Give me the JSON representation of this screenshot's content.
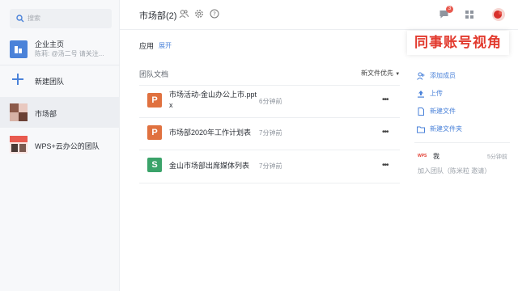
{
  "sidebar": {
    "search_placeholder": "搜索",
    "items": [
      {
        "title": "企业主页",
        "subtitle": "陈莉: @汤二号 请关注..."
      },
      {
        "title": "新建团队"
      },
      {
        "title": "市场部"
      },
      {
        "title": "WPS+云办公的团队"
      }
    ]
  },
  "header": {
    "title": "市场部(2)"
  },
  "apps": {
    "label": "应用",
    "expand": "展开"
  },
  "watermark": "同事账号视角",
  "notification_count": "3",
  "docs": {
    "section_label": "团队文档",
    "sort_label": "新文件优先",
    "files": [
      {
        "name_line1": "市场活动-金山办公上市.ppt",
        "name_line2": "x",
        "time": "6分钟前",
        "type": "P",
        "color": "#e0713f"
      },
      {
        "name_line1": "市场部2020年工作计划表",
        "name_line2": "",
        "time": "7分钟前",
        "type": "P",
        "color": "#e0713f"
      },
      {
        "name_line1": "金山市场部出席媒体列表",
        "name_line2": "",
        "time": "7分钟前",
        "type": "S",
        "color": "#3ba36a"
      }
    ]
  },
  "actions": [
    {
      "label": "添加成员",
      "icon": "add-member-icon"
    },
    {
      "label": "上传",
      "icon": "upload-icon"
    },
    {
      "label": "新建文件",
      "icon": "new-file-icon"
    },
    {
      "label": "新建文件夹",
      "icon": "new-folder-icon"
    }
  ],
  "activity": {
    "logo_text": "WPS",
    "user": "我",
    "time": "5分钟前",
    "description": "加入团队（陈米粒 邀请）"
  },
  "colors": {
    "accent": "#4a82d9",
    "ppt": "#e0713f",
    "sheet": "#3ba36a",
    "watermark": "#e23a2e"
  }
}
